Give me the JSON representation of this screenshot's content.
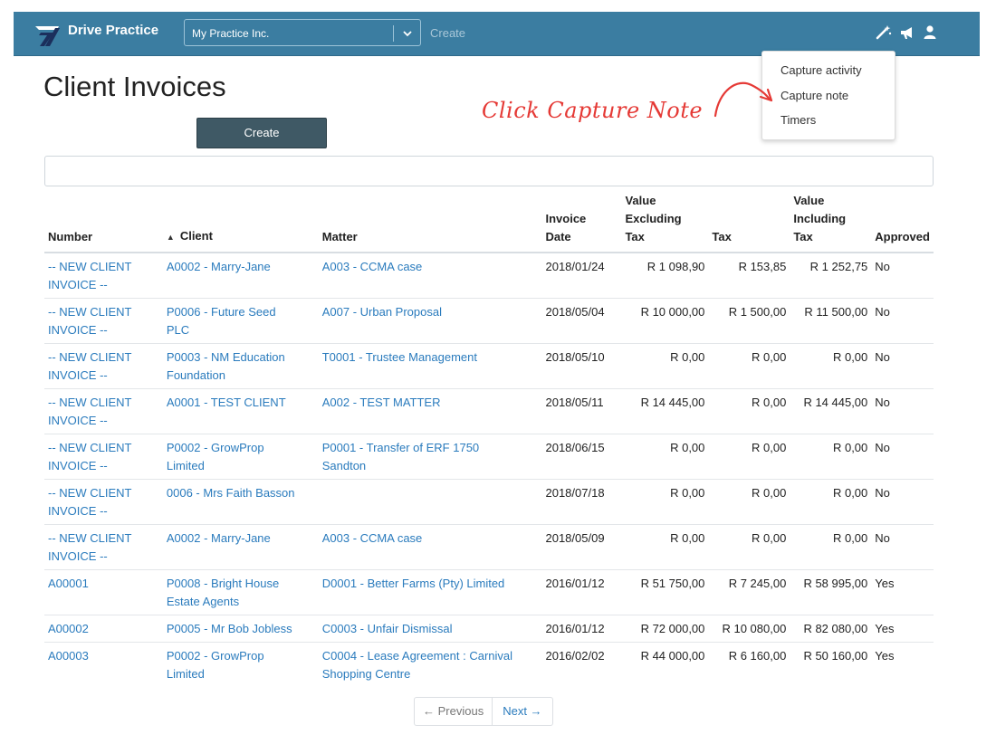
{
  "navbar": {
    "brand": "Drive Practice",
    "practice": "My Practice Inc.",
    "create_label": "Create",
    "icons": [
      "magic-wand-icon",
      "megaphone-icon",
      "user-icon"
    ]
  },
  "dropdown": {
    "items": [
      "Capture activity",
      "Capture note",
      "Timers"
    ]
  },
  "page": {
    "title": "Client Invoices",
    "create_button": "Create",
    "annotation": "Click Capture Note"
  },
  "table": {
    "headers": {
      "number": "Number",
      "client": "Client",
      "matter": "Matter",
      "invoice_date_1": "Invoice",
      "invoice_date_2": "Date",
      "value_ex_1": "Value",
      "value_ex_2": "Excluding",
      "value_ex_3": "Tax",
      "tax": "Tax",
      "value_inc_1": "Value",
      "value_inc_2": "Including",
      "value_inc_3": "Tax",
      "approved": "Approved"
    },
    "rows": [
      {
        "n1": "-- NEW CLIENT",
        "n2": "INVOICE --",
        "c1": "A0002 - Marry-Jane",
        "c2": "",
        "m1": "A003 - CCMA case",
        "m2": "",
        "date": "2018/01/24",
        "ex": "R 1 098,90",
        "tax": "R 153,85",
        "inc": "R 1 252,75",
        "approved": "No"
      },
      {
        "n1": "-- NEW CLIENT",
        "n2": "INVOICE --",
        "c1": "P0006 - Future Seed",
        "c2": "PLC",
        "m1": "A007 - Urban Proposal",
        "m2": "",
        "date": "2018/05/04",
        "ex": "R 10 000,00",
        "tax": "R 1 500,00",
        "inc": "R 11 500,00",
        "approved": "No"
      },
      {
        "n1": "-- NEW CLIENT",
        "n2": "INVOICE --",
        "c1": "P0003 - NM Education",
        "c2": "Foundation",
        "m1": "T0001 - Trustee Management",
        "m2": "",
        "date": "2018/05/10",
        "ex": "R 0,00",
        "tax": "R 0,00",
        "inc": "R 0,00",
        "approved": "No"
      },
      {
        "n1": "-- NEW CLIENT",
        "n2": "INVOICE --",
        "c1": "A0001 - TEST CLIENT",
        "c2": "",
        "m1": "A002 - TEST MATTER",
        "m2": "",
        "date": "2018/05/11",
        "ex": "R 14 445,00",
        "tax": "R 0,00",
        "inc": "R 14 445,00",
        "approved": "No"
      },
      {
        "n1": "-- NEW CLIENT",
        "n2": "INVOICE --",
        "c1": "P0002 - GrowProp",
        "c2": "Limited",
        "m1": "P0001 - Transfer of ERF 1750",
        "m2": "Sandton",
        "date": "2018/06/15",
        "ex": "R 0,00",
        "tax": "R 0,00",
        "inc": "R 0,00",
        "approved": "No"
      },
      {
        "n1": "-- NEW CLIENT",
        "n2": "INVOICE --",
        "c1": "0006 - Mrs Faith Basson",
        "c2": "",
        "m1": "",
        "m2": "",
        "date": "2018/07/18",
        "ex": "R 0,00",
        "tax": "R 0,00",
        "inc": "R 0,00",
        "approved": "No"
      },
      {
        "n1": "-- NEW CLIENT",
        "n2": "INVOICE --",
        "c1": "A0002 - Marry-Jane",
        "c2": "",
        "m1": "A003 - CCMA case",
        "m2": "",
        "date": "2018/05/09",
        "ex": "R 0,00",
        "tax": "R 0,00",
        "inc": "R 0,00",
        "approved": "No"
      },
      {
        "n1": "A00001",
        "n2": "",
        "c1": "P0008 - Bright House",
        "c2": "Estate Agents",
        "m1": "D0001 - Better Farms (Pty) Limited",
        "m2": "",
        "date": "2016/01/12",
        "ex": "R 51 750,00",
        "tax": "R 7 245,00",
        "inc": "R 58 995,00",
        "approved": "Yes"
      },
      {
        "n1": "A00002",
        "n2": "",
        "c1": "P0005 - Mr Bob Jobless",
        "c2": "",
        "m1": "C0003 - Unfair Dismissal",
        "m2": "",
        "date": "2016/01/12",
        "ex": "R 72 000,00",
        "tax": "R 10 080,00",
        "inc": "R 82 080,00",
        "approved": "Yes"
      },
      {
        "n1": "A00003",
        "n2": "",
        "c1": "P0002 - GrowProp",
        "c2": "Limited",
        "m1": "C0004 - Lease Agreement : Carnival",
        "m2": "Shopping Centre",
        "date": "2016/02/02",
        "ex": "R 44 000,00",
        "tax": "R 6 160,00",
        "inc": "R 50 160,00",
        "approved": "Yes"
      }
    ]
  },
  "pager": {
    "previous": "← Previous",
    "next": "Next →"
  },
  "colors": {
    "navbar": "#3b7da1",
    "link": "#2a7bbd",
    "annotation": "#e53935",
    "create_button": "#3f5965"
  }
}
